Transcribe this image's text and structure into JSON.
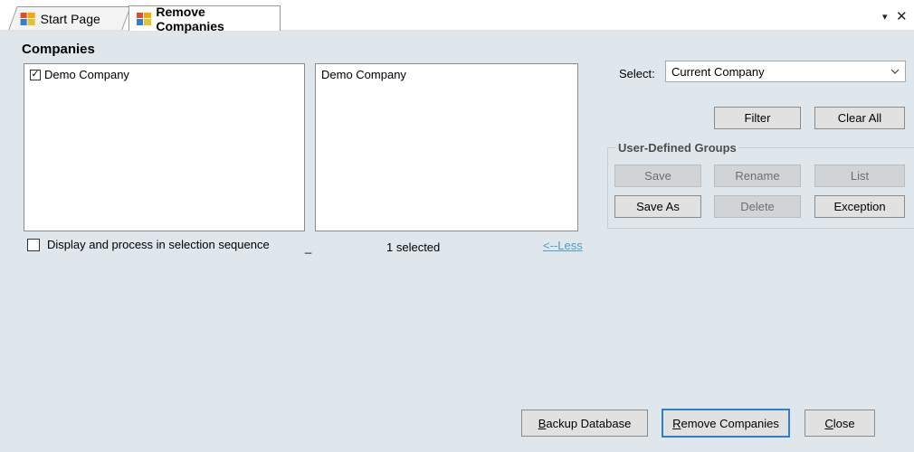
{
  "tabs": [
    {
      "label": "Start Page",
      "active": false
    },
    {
      "label": "Remove Companies",
      "active": true
    }
  ],
  "window_controls": {
    "pin": "▾",
    "close": "✕"
  },
  "companies": {
    "title": "Companies",
    "left_list": [
      {
        "label": "Demo Company",
        "checked": true
      }
    ],
    "right_list": [
      {
        "label": "Demo Company"
      }
    ],
    "sequence_checkbox_label": "Display and process in selection sequence",
    "sequence_checked": false,
    "underscore": "_",
    "selected_count": "1 selected",
    "less_link": "<--Less"
  },
  "select": {
    "label": "Select:",
    "value": "Current Company"
  },
  "buttons": {
    "filter": "Filter",
    "clear_all": "Clear All"
  },
  "user_groups": {
    "title": "User-Defined Groups",
    "save": "Save",
    "rename": "Rename",
    "list": "List",
    "save_as": "Save As",
    "delete": "Delete",
    "exception": "Exception"
  },
  "footer": {
    "backup_first": "B",
    "backup_rest": "ackup Database",
    "remove_first": "R",
    "remove_rest": "emove Companies",
    "close_first": "C",
    "close_rest": "lose"
  },
  "colors": {
    "background": "#dfe7ed",
    "link": "#4f9bc9",
    "accent_border": "#2f7fd1"
  }
}
